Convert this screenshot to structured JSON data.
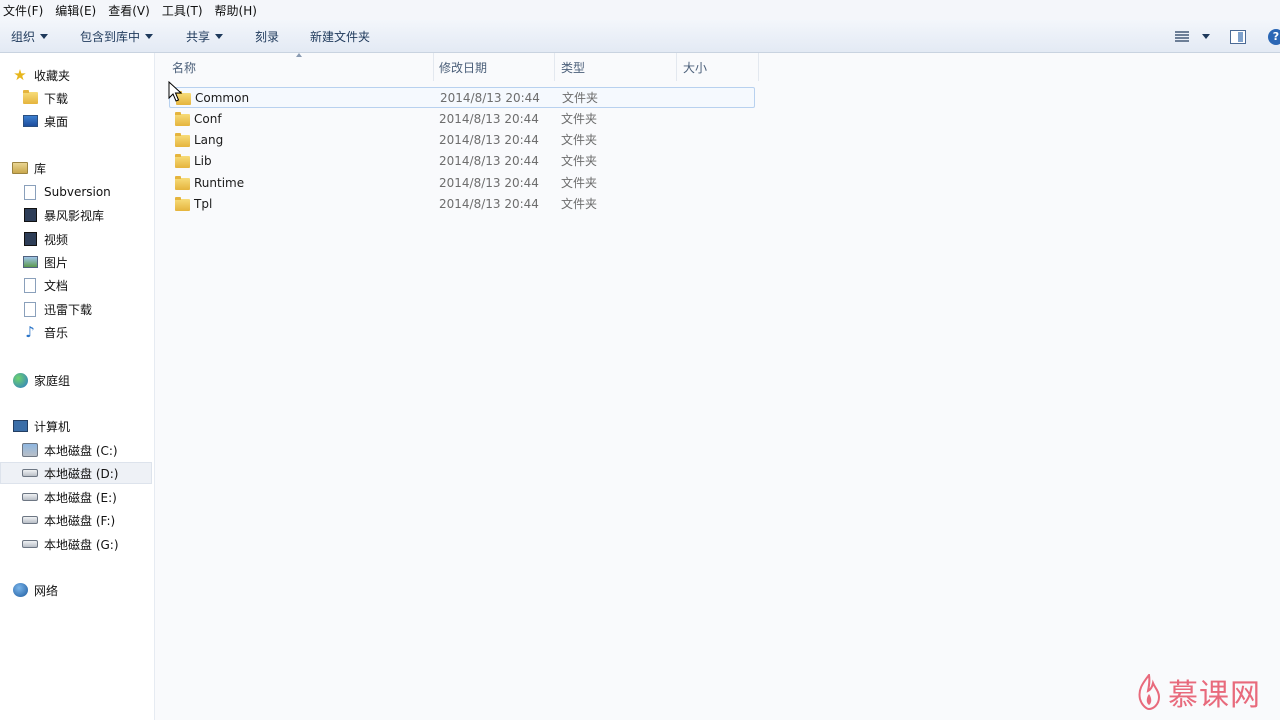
{
  "menubar": {
    "items": [
      "文件(F)",
      "编辑(E)",
      "查看(V)",
      "工具(T)",
      "帮助(H)"
    ]
  },
  "toolbar": {
    "organize": "组织",
    "include_in_library": "包含到库中",
    "share": "共享",
    "burn": "刻录",
    "new_folder": "新建文件夹",
    "help": "?"
  },
  "nav": {
    "favorites": "收藏夹",
    "downloads": "下载",
    "desktop": "桌面",
    "libraries": "库",
    "subversion": "Subversion",
    "baofeng": "暴风影视库",
    "videos": "视频",
    "pictures": "图片",
    "documents": "文档",
    "xunlei": "迅雷下载",
    "music": "音乐",
    "homegroup": "家庭组",
    "computer": "计算机",
    "drive_c": "本地磁盘 (C:)",
    "drive_d": "本地磁盘 (D:)",
    "drive_e": "本地磁盘 (E:)",
    "drive_f": "本地磁盘 (F:)",
    "drive_g": "本地磁盘 (G:)",
    "network": "网络"
  },
  "columns": {
    "name": "名称",
    "modified": "修改日期",
    "type": "类型",
    "size": "大小"
  },
  "files": [
    {
      "name": "Common",
      "modified": "2014/8/13 20:44",
      "type": "文件夹"
    },
    {
      "name": "Conf",
      "modified": "2014/8/13 20:44",
      "type": "文件夹"
    },
    {
      "name": "Lang",
      "modified": "2014/8/13 20:44",
      "type": "文件夹"
    },
    {
      "name": "Lib",
      "modified": "2014/8/13 20:44",
      "type": "文件夹"
    },
    {
      "name": "Runtime",
      "modified": "2014/8/13 20:44",
      "type": "文件夹"
    },
    {
      "name": "Tpl",
      "modified": "2014/8/13 20:44",
      "type": "文件夹"
    }
  ],
  "watermark": "慕课网",
  "colors": {
    "toolbar_text": "#1e395b",
    "hover_border": "#b8d1ef",
    "watermark": "#e86a7c"
  }
}
